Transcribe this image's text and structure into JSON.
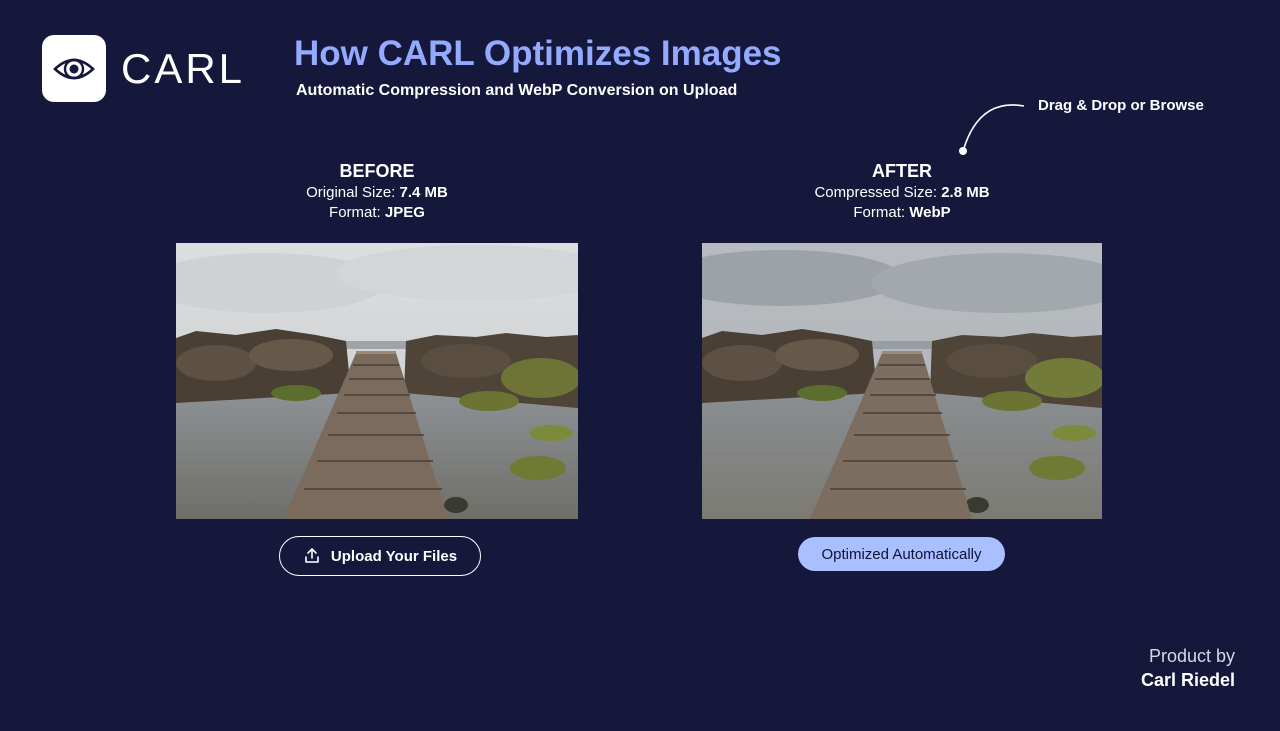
{
  "brand": {
    "logo_text": "CARL"
  },
  "header": {
    "title": "How CARL Optimizes Images",
    "subtitle": "Automatic Compression and WebP Conversion on Upload"
  },
  "hint": {
    "text": "Drag & Drop or Browse"
  },
  "before": {
    "heading": "BEFORE",
    "size_label": "Original Size:",
    "size_value": "7.4 MB",
    "format_label": "Format:",
    "format_value": "JPEG"
  },
  "after": {
    "heading": "AFTER",
    "size_label": "Compressed Size:",
    "size_value": "2.8 MB",
    "format_label": "Format:",
    "format_value": "WebP"
  },
  "actions": {
    "upload_label": "Upload Your Files",
    "upload_icon": "upload-icon",
    "optimized_label": "Optimized Automatically"
  },
  "credit": {
    "by": "Product by",
    "name": "Carl Riedel"
  },
  "colors": {
    "background": "#15173b",
    "title_accent": "#93aaff",
    "badge_fill": "#a9bfff"
  }
}
